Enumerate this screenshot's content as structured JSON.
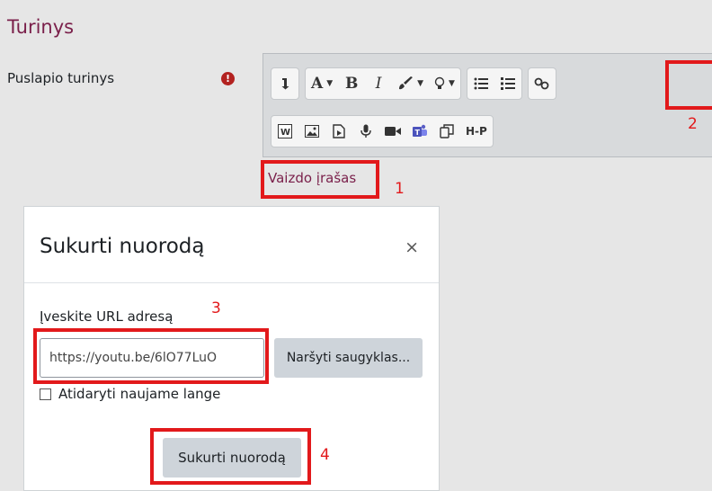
{
  "section": {
    "title": "Turinys"
  },
  "field": {
    "label": "Puslapio turinys",
    "required_icon": "exclamation-icon"
  },
  "editor": {
    "toolbar_row1": [
      {
        "name": "collapse-toolbar-icon"
      },
      {
        "name": "font-style-icon",
        "label": "A"
      },
      {
        "name": "bold-icon",
        "label": "B"
      },
      {
        "name": "italic-icon",
        "label": "I"
      },
      {
        "name": "brush-icon"
      },
      {
        "name": "lightbulb-icon"
      },
      {
        "name": "bullet-list-icon"
      },
      {
        "name": "numbered-list-icon"
      },
      {
        "name": "link-icon"
      }
    ],
    "toolbar_row2": [
      {
        "name": "word-icon",
        "label": "W"
      },
      {
        "name": "image-icon"
      },
      {
        "name": "media-icon"
      },
      {
        "name": "microphone-icon"
      },
      {
        "name": "video-camera-icon"
      },
      {
        "name": "teams-icon"
      },
      {
        "name": "copy-icon"
      },
      {
        "name": "h5p-icon",
        "label": "H-P"
      }
    ],
    "selected_text": "Vaizdo įrašas"
  },
  "annotations": {
    "n1": "1",
    "n2": "2",
    "n3": "3",
    "n4": "4",
    "color": "#e2191b"
  },
  "modal": {
    "title": "Sukurti nuorodą",
    "close_label": "×",
    "url_label": "Įveskite URL adresą",
    "url_value": "https://youtu.be/6lO77LuO",
    "browse_label": "Naršyti saugyklas...",
    "new_window_label": "Atidaryti naujame lange",
    "create_label": "Sukurti nuorodą"
  },
  "colors": {
    "accent": "#7a1f4a",
    "required": "#b32220"
  }
}
